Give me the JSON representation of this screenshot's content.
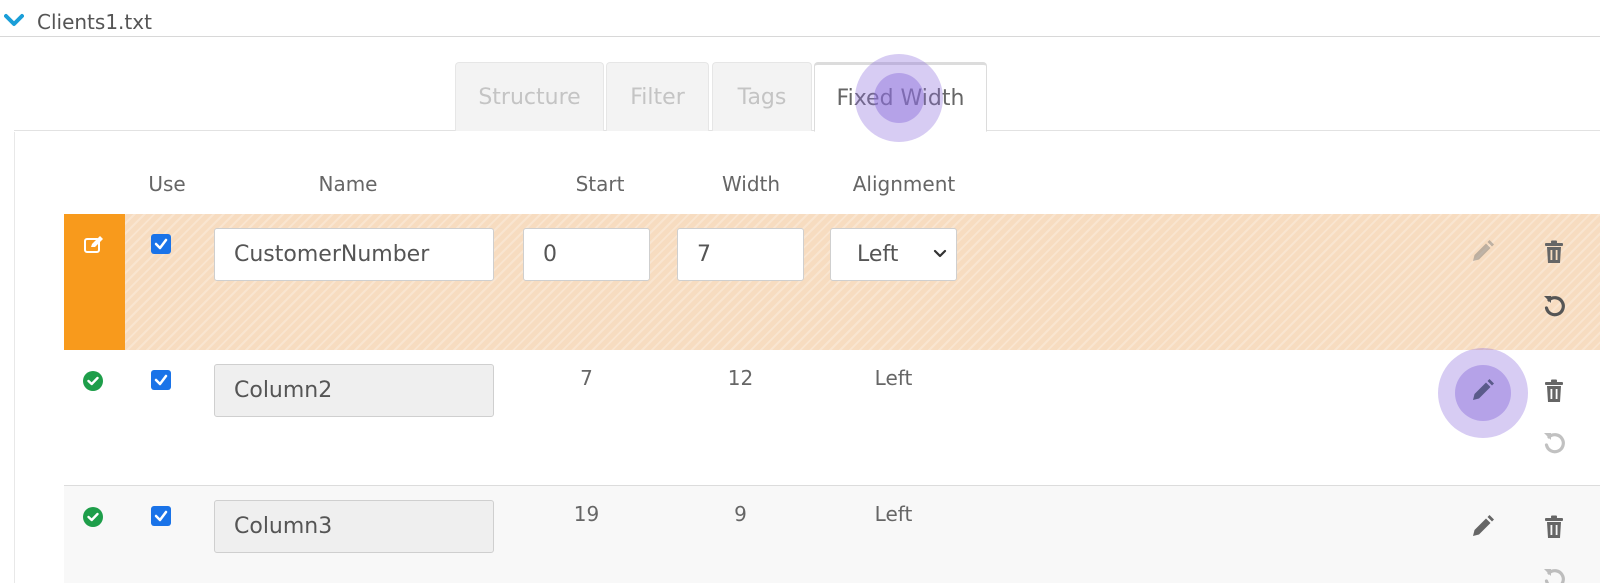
{
  "header": {
    "file_title": "Clients1.txt"
  },
  "tabs": [
    {
      "label": "Structure",
      "active": false
    },
    {
      "label": "Filter",
      "active": false
    },
    {
      "label": "Tags",
      "active": false
    },
    {
      "label": "Fixed Width",
      "active": true
    }
  ],
  "columns": {
    "use": "Use",
    "name": "Name",
    "start": "Start",
    "width": "Width",
    "alignment": "Alignment"
  },
  "rows": [
    {
      "status": "editing",
      "use": true,
      "name": "CustomerNumber",
      "start": "0",
      "width": "7",
      "alignment": "Left"
    },
    {
      "status": "valid",
      "use": true,
      "name": "Column2",
      "start": "7",
      "width": "12",
      "alignment": "Left"
    },
    {
      "status": "valid",
      "use": true,
      "name": "Column3",
      "start": "19",
      "width": "9",
      "alignment": "Left"
    }
  ],
  "colors": {
    "accent_blue": "#1a73e8",
    "edit_orange": "#f89a1c",
    "edit_row_bg": "#f7dcc0",
    "valid_green": "#1e9e4a",
    "icon_gray": "#666666",
    "click_highlight": "#8c6edc"
  },
  "icons": {
    "header_toggle": "chevron-down-icon",
    "row_editing": "edit-note-icon",
    "row_valid": "check-circle-icon",
    "edit": "pencil-icon",
    "delete": "trash-icon",
    "undo": "undo-icon"
  }
}
